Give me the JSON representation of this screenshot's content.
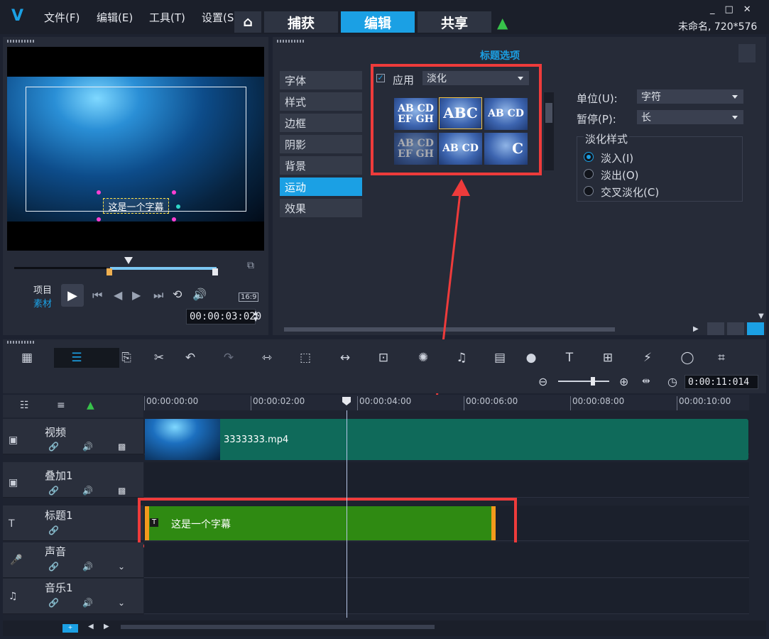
{
  "menu": [
    "文件(F)",
    "编辑(E)",
    "工具(T)",
    "设置(S)"
  ],
  "tabs": [
    {
      "label": "捕获"
    },
    {
      "label": "编辑"
    },
    {
      "label": "共享"
    }
  ],
  "project": "未命名, 720*576",
  "preview": {
    "subtitle": "这是一个字幕",
    "mode_project": "项目",
    "mode_clip": "素材",
    "aspect": "16:9",
    "timecode": "00:00:03:020"
  },
  "options": {
    "title": "标题选项",
    "side": [
      "字体",
      "样式",
      "边框",
      "阴影",
      "背景",
      "运动",
      "效果"
    ],
    "apply_label": "应用",
    "effect": "淡化",
    "thumbs": [
      "AB CD EF GH",
      "ABC",
      "AB CD",
      "AB CD EF GH",
      "AB CD",
      "C"
    ],
    "unit_label": "单位(U):",
    "unit_value": "字符",
    "pause_label": "暂停(P):",
    "pause_value": "长",
    "fade_style": "淡化样式",
    "fade_in": "淡入(I)",
    "fade_out": "淡出(O)",
    "cross_fade": "交叉淡化(C)"
  },
  "toolbar": {
    "timecode": "0:00:11:014"
  },
  "ruler": [
    "00:00:00:00",
    "00:00:02:00",
    "00:00:04:00",
    "00:00:06:00",
    "00:00:08:00",
    "00:00:10:00"
  ],
  "tracks": [
    {
      "name": "视频",
      "clip": "3333333.mp4"
    },
    {
      "name": "叠加1"
    },
    {
      "name": "标题1",
      "clip": "这是一个字幕"
    },
    {
      "name": "声音"
    },
    {
      "name": "音乐1"
    }
  ],
  "colors": {
    "accent": "#1ba0e4",
    "title_clip": "#2f8a12",
    "video_clip": "#0f6a5a",
    "highlight": "#ee3b3b"
  }
}
